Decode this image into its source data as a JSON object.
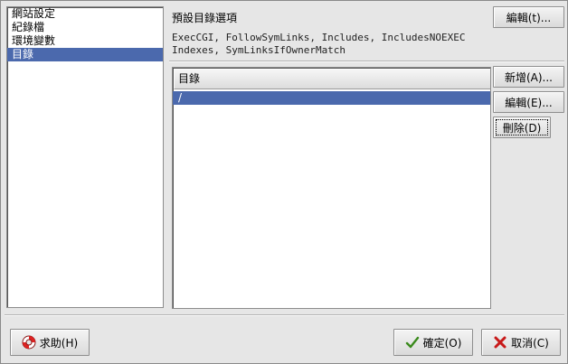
{
  "sidebar": {
    "items": [
      {
        "label": "網站設定"
      },
      {
        "label": "紀錄檔"
      },
      {
        "label": "環境變數"
      },
      {
        "label": "目錄",
        "selected": true
      }
    ]
  },
  "main": {
    "title": "預設目錄選項",
    "options_line1": "ExecCGI, FollowSymLinks, Includes, IncludesNOEXEC",
    "options_line2": "Indexes, SymLinksIfOwnerMatch",
    "edit_options_label": "編輯(t)...",
    "directory_list": {
      "column_header": "目錄",
      "rows": [
        {
          "path": "/",
          "selected": true
        }
      ]
    },
    "add_label": "新增(A)...",
    "edit_label": "編輯(E)...",
    "delete_label": "刪除(D)"
  },
  "footer": {
    "help_label": "求助(H)",
    "ok_label": "確定(O)",
    "cancel_label": "取消(C)"
  },
  "colors": {
    "selection": "#4b69ad",
    "background": "#e6e6e6"
  },
  "icons": {
    "help": "lifebuoy-icon",
    "ok": "checkmark-icon",
    "cancel": "x-icon"
  }
}
